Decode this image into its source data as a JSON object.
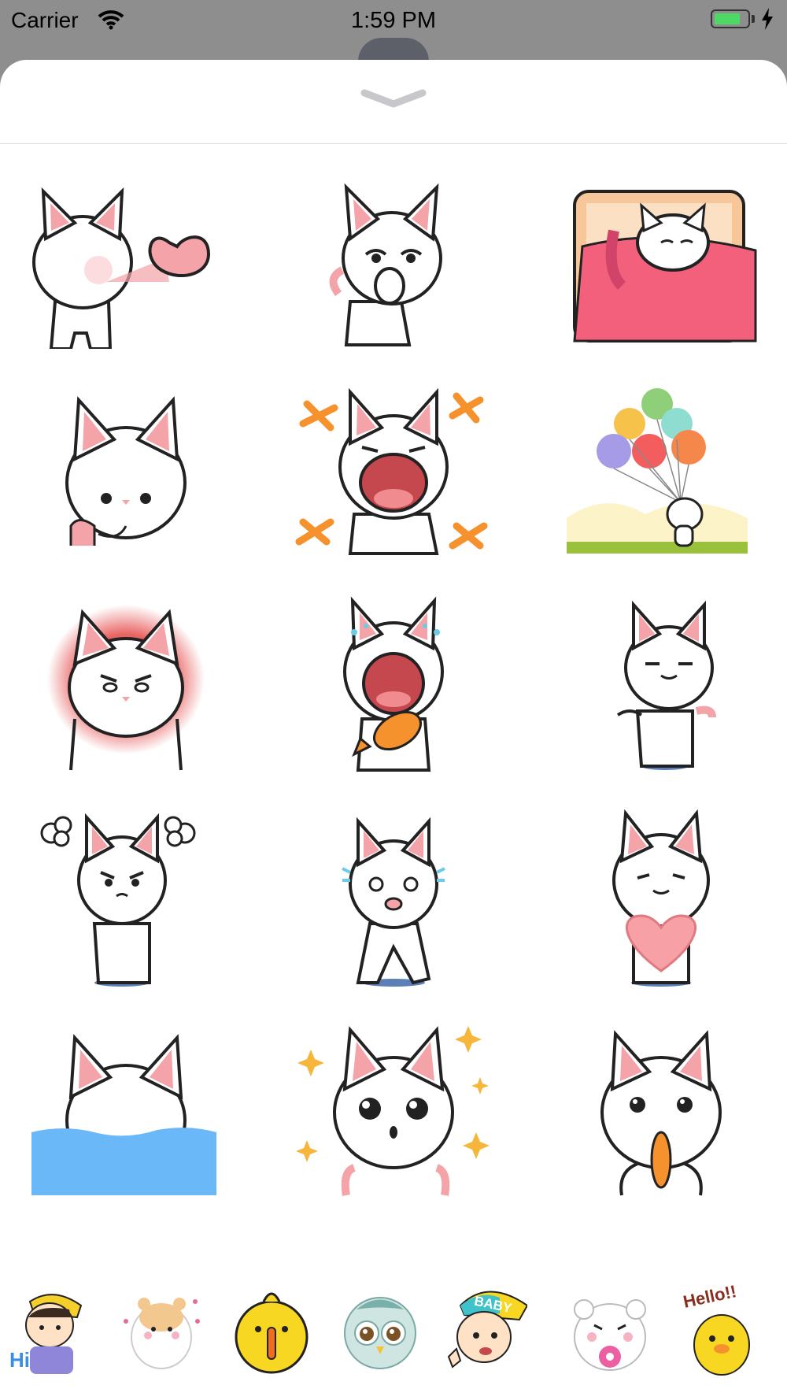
{
  "status_bar": {
    "carrier": "Carrier",
    "time": "1:59 PM",
    "battery_level": 0.75
  },
  "sheet": {
    "collapse_icon": "chevron-down-icon"
  },
  "stickers": [
    {
      "name": "cat-blowing-heart"
    },
    {
      "name": "cat-yawning"
    },
    {
      "name": "cat-sleeping-in-bed"
    },
    {
      "name": "cat-peeking"
    },
    {
      "name": "cat-crying-loud"
    },
    {
      "name": "cat-floating-balloons"
    },
    {
      "name": "cat-angry-red"
    },
    {
      "name": "cat-crying-with-fish"
    },
    {
      "name": "cat-content-eyes-closed"
    },
    {
      "name": "cat-fuming"
    },
    {
      "name": "cat-running-scared"
    },
    {
      "name": "cat-holding-heart"
    },
    {
      "name": "cat-in-water"
    },
    {
      "name": "cat-amazed-sparkles"
    },
    {
      "name": "cat-eating-fish"
    }
  ],
  "tray": [
    {
      "name": "boy-hi-pack",
      "text": "Hi"
    },
    {
      "name": "hamster-pack",
      "text": ""
    },
    {
      "name": "yellow-chick-pack",
      "text": ""
    },
    {
      "name": "owl-pack",
      "text": ""
    },
    {
      "name": "baby-pack",
      "text": "BABY"
    },
    {
      "name": "bear-donut-pack",
      "text": ""
    },
    {
      "name": "duck-hello-pack",
      "text": "Hello!!"
    }
  ],
  "colors": {
    "accent_pink": "#f4a3a8",
    "cat_white": "#ffffff",
    "water_blue": "#6bb8f9",
    "orange": "#f6922d"
  }
}
